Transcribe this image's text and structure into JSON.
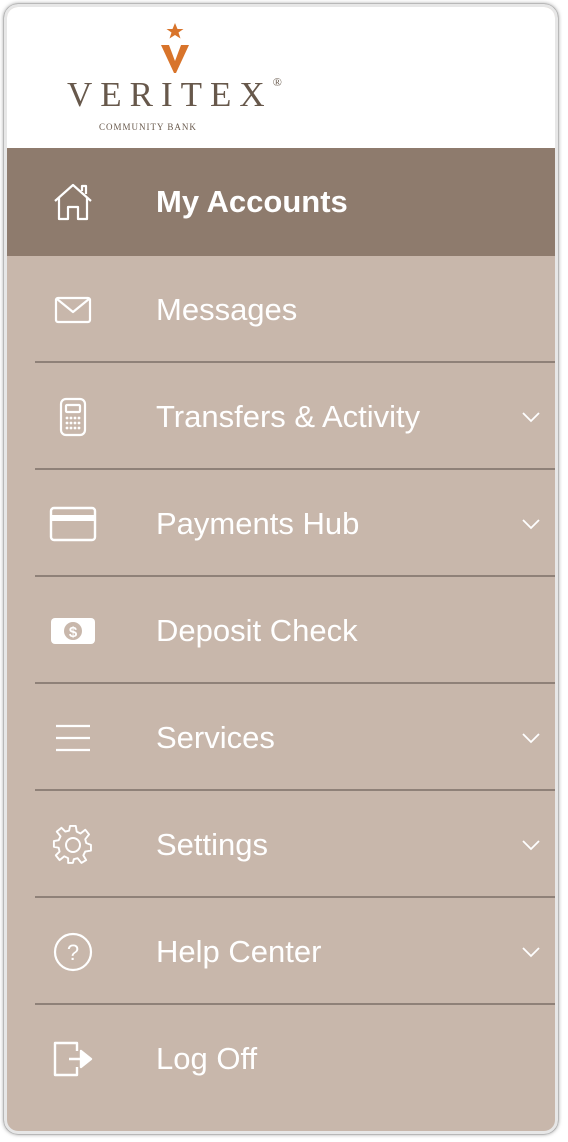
{
  "brand": {
    "name": "VERITEX",
    "registered": "®",
    "tagline": "COMMUNITY BANK",
    "colors": {
      "accent": "#d8742b",
      "text": "#67584b",
      "menu_bg": "#c8b7ab",
      "menu_active_bg": "#8e7b6d",
      "divider": "#8f8178"
    }
  },
  "menu": {
    "items": [
      {
        "label": "My Accounts",
        "icon": "home-icon",
        "active": true,
        "expandable": false
      },
      {
        "label": "Messages",
        "icon": "envelope-icon",
        "active": false,
        "expandable": false
      },
      {
        "label": "Transfers & Activity",
        "icon": "calculator-icon",
        "active": false,
        "expandable": true
      },
      {
        "label": "Payments Hub",
        "icon": "credit-card-icon",
        "active": false,
        "expandable": true
      },
      {
        "label": "Deposit Check",
        "icon": "cash-icon",
        "active": false,
        "expandable": false
      },
      {
        "label": "Services",
        "icon": "hamburger-icon",
        "active": false,
        "expandable": true
      },
      {
        "label": "Settings",
        "icon": "gear-icon",
        "active": false,
        "expandable": true
      },
      {
        "label": "Help Center",
        "icon": "help-icon",
        "active": false,
        "expandable": true
      },
      {
        "label": "Log Off",
        "icon": "logout-icon",
        "active": false,
        "expandable": false
      }
    ]
  }
}
